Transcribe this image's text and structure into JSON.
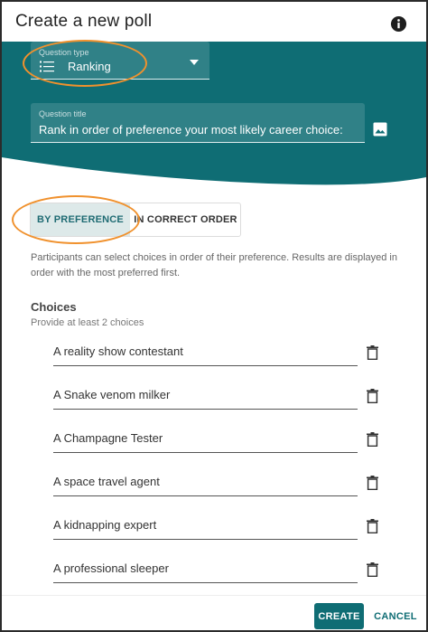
{
  "dialog": {
    "title": "Create a new poll",
    "info_icon": "info-icon"
  },
  "colors": {
    "teal": "#0f6d74",
    "accent_ring": "#f0912d",
    "selected_bg": "#dde9e9"
  },
  "question_type": {
    "label": "Question type",
    "value": "Ranking",
    "icon": "list-icon"
  },
  "question_title": {
    "label": "Question title",
    "value": "Rank in order of preference your most likely career choice:",
    "icon": "image-icon"
  },
  "mode_toggle": {
    "by_preference": "BY PREFERENCE",
    "in_correct_order": "IN CORRECT ORDER",
    "selected": "by_preference"
  },
  "description": "Participants can select choices in order of their preference. Results are displayed in order with the most preferred first.",
  "choices": {
    "title": "Choices",
    "hint": "Provide at least 2 choices",
    "items": [
      "A reality show contestant",
      "A Snake venom milker",
      "A Champagne Tester",
      "A space travel agent",
      "A kidnapping expert",
      "A professional sleeper"
    ],
    "delete_icon": "trash-icon"
  },
  "footer": {
    "create": "CREATE",
    "cancel": "CANCEL"
  }
}
